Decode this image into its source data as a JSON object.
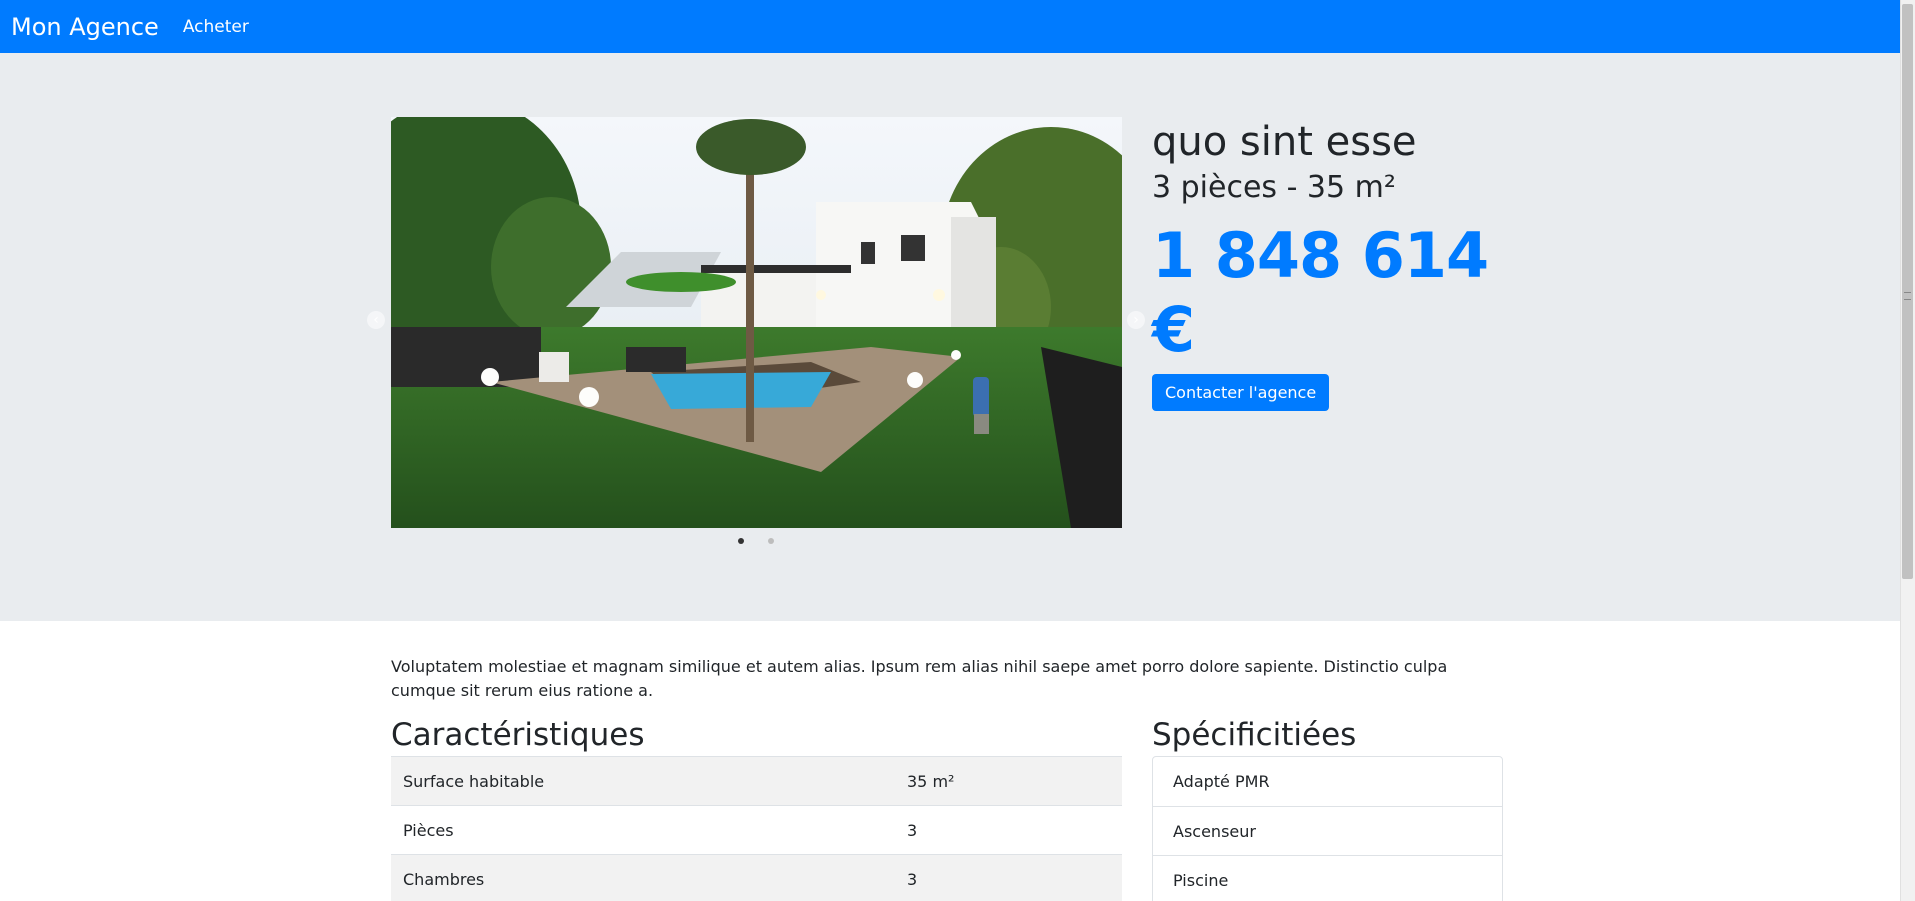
{
  "navbar": {
    "brand": "Mon Agence",
    "link": "Acheter",
    "color": "#007bff"
  },
  "hero": {
    "title": "quo sint esse",
    "subtitle": "3 pièces - 35 m²",
    "price": "1 848 614 €",
    "contact_button": "Contacter l'agence",
    "carousel": {
      "slides": 2,
      "active": 1,
      "prev_icon": "chevron-left-icon",
      "next_icon": "chevron-right-icon"
    }
  },
  "description": "Voluptatem molestiae et magnam similique et autem alias. Ipsum rem alias nihil saepe amet porro dolore sapiente. Distinctio culpa cumque sit rerum eius ratione a.",
  "characteristics": {
    "heading": "Caractéristiques",
    "rows": [
      {
        "label": "Surface habitable",
        "value": "35 m²"
      },
      {
        "label": "Pièces",
        "value": "3"
      },
      {
        "label": "Chambres",
        "value": "3"
      }
    ]
  },
  "specifics": {
    "heading": "Spécificitiées",
    "items": [
      "Adapté PMR",
      "Ascenseur",
      "Piscine"
    ]
  }
}
